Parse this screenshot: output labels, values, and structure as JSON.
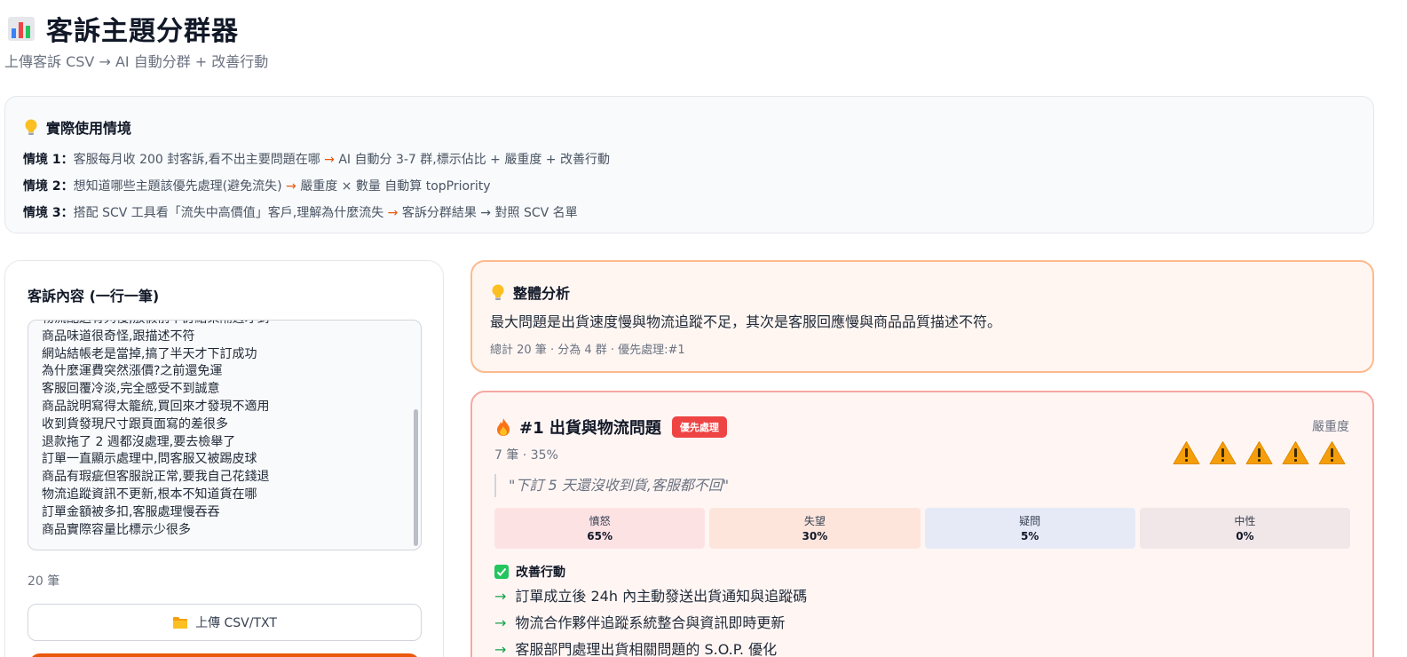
{
  "header": {
    "title": "客訴主題分群器",
    "title_icon": "bar-chart-icon",
    "subtitle": "上傳客訴 CSV → AI 自動分群 + 改善行動"
  },
  "scenarios": {
    "heading": "實際使用情境",
    "heading_icon": "lightbulb-icon",
    "items": [
      {
        "label": "情境 1：",
        "before": "客服每月收 200 封客訴,看不出主要問題在哪",
        "arrow": "→",
        "after": "AI 自動分 3-7 群,標示佔比 + 嚴重度 + 改善行動"
      },
      {
        "label": "情境 2：",
        "before": "想知道哪些主題該優先處理(避免流失)",
        "arrow": "→",
        "after": "嚴重度 × 數量 自動算 topPriority"
      },
      {
        "label": "情境 3：",
        "before": "搭配 SCV 工具看「流失中高價值」客戶,理解為什麼流失",
        "arrow": "→",
        "after": "客訴分群結果 → 對照 SCV 名單"
      }
    ]
  },
  "input": {
    "title": "客訴內容 (一行一筆)",
    "lines": [
      "物流配送有夠慢,放假前下訂結果隔週才到",
      "商品味道很奇怪,跟描述不符",
      "網站結帳老是當掉,搞了半天才下訂成功",
      "為什麼運費突然漲價?之前還免運",
      "客服回覆冷淡,完全感受不到誠意",
      "商品說明寫得太籠統,買回來才發現不適用",
      "收到貨發現尺寸跟頁面寫的差很多",
      "退款拖了 2 週都沒處理,要去檢舉了",
      "訂單一直顯示處理中,問客服又被踢皮球",
      "商品有瑕疵但客服說正常,要我自己花錢退",
      "物流追蹤資訊不更新,根本不知道貨在哪",
      "訂單金額被多扣,客服處理慢吞吞",
      "商品實際容量比標示少很多"
    ],
    "count": "20 筆",
    "upload_label": "上傳 CSV/TXT",
    "upload_icon": "folder-icon"
  },
  "overall": {
    "heading": "整體分析",
    "heading_icon": "lightbulb-icon",
    "summary": "最大問題是出貨速度慢與物流追蹤不足，其次是客服回應慢與商品品質描述不符。",
    "meta": "總計 20 筆 · 分為 4 群 · 優先處理:#1"
  },
  "cluster": {
    "icon": "fire-icon",
    "name": "#1 出貨與物流問題",
    "badge": "優先處理",
    "severity_label": "嚴重度",
    "severity_level": 5,
    "meta": "7 筆 · 35%",
    "quote": "\"下訂 5 天還沒收到貨,客服都不回\"",
    "sentiments": [
      {
        "label": "憤怒",
        "value": "65%",
        "color": "#fde2e4"
      },
      {
        "label": "失望",
        "value": "30%",
        "color": "#fde5dc"
      },
      {
        "label": "疑問",
        "value": "5%",
        "color": "#e6eaf7"
      },
      {
        "label": "中性",
        "value": "0%",
        "color": "#f1e6e8"
      }
    ],
    "actions_heading": "改善行動",
    "actions_icon": "check-icon",
    "actions": [
      "訂單成立後 24h 內主動發送出貨通知與追蹤碼",
      "物流合作夥伴追蹤系統整合與資訊即時更新",
      "客服部門處理出貨相關問題的 S.O.P. 優化"
    ]
  },
  "colors": {
    "accent": "#ea580c",
    "priority": "#ef4444",
    "action_arrow": "#16a34a"
  }
}
